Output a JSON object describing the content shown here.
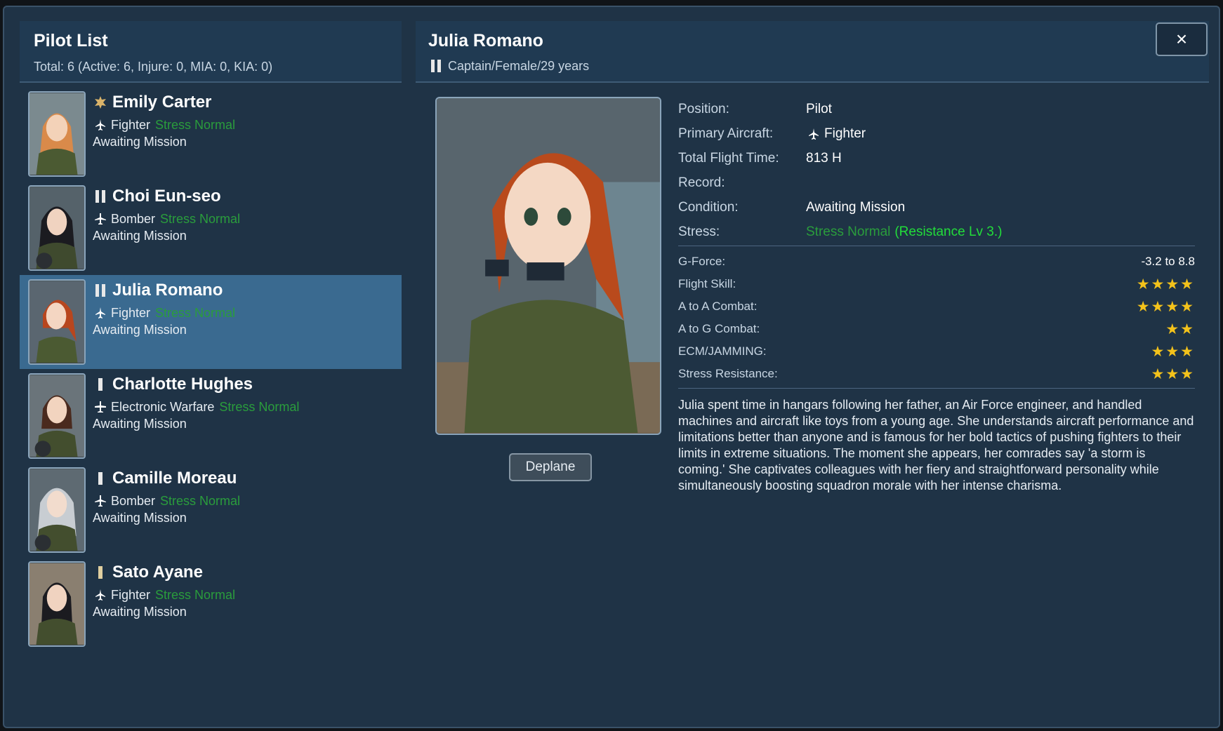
{
  "left": {
    "title": "Pilot List",
    "summary": "Total: 6 (Active: 6, Injure: 0, MIA: 0, KIA: 0)"
  },
  "pilots": [
    {
      "name": "Emily Carter",
      "type": "Fighter",
      "stress": "Stress Normal",
      "status": "Awaiting Mission",
      "rank_icon": "gold-leaf-rank-icon",
      "selected": false
    },
    {
      "name": "Choi Eun-seo",
      "type": "Bomber",
      "stress": "Stress Normal",
      "status": "Awaiting Mission",
      "rank_icon": "captain-bars-rank-icon",
      "selected": false
    },
    {
      "name": "Julia Romano",
      "type": "Fighter",
      "stress": "Stress Normal",
      "status": "Awaiting Mission",
      "rank_icon": "captain-bars-rank-icon",
      "selected": true
    },
    {
      "name": "Charlotte Hughes",
      "type": "Electronic Warfare",
      "stress": "Stress Normal",
      "status": "Awaiting Mission",
      "rank_icon": "lieutenant-bar-rank-icon",
      "selected": false
    },
    {
      "name": "Camille Moreau",
      "type": "Bomber",
      "stress": "Stress Normal",
      "status": "Awaiting Mission",
      "rank_icon": "lieutenant-bar-rank-icon",
      "selected": false
    },
    {
      "name": "Sato Ayane",
      "type": "Fighter",
      "stress": "Stress Normal",
      "status": "Awaiting Mission",
      "rank_icon": "ensign-bar-rank-icon",
      "selected": false
    }
  ],
  "detail": {
    "name": "Julia Romano",
    "subtitle": "Captain/Female/29 years",
    "close_label": "×",
    "deplane_label": "Deplane",
    "stats": [
      {
        "label": "Position:",
        "value": "Pilot"
      },
      {
        "label": "Primary Aircraft:",
        "value": "Fighter"
      },
      {
        "label": "Total Flight Time:",
        "value": "813 H"
      },
      {
        "label": "Record:",
        "value": ""
      },
      {
        "label": "Condition:",
        "value": "Awaiting Mission"
      }
    ],
    "stress_label": "Stress:",
    "stress_value": "Stress Normal",
    "stress_resist": "(Resistance Lv 3.)",
    "gforce_label": "G-Force:",
    "gforce_value": "-3.2 to 8.8",
    "attributes": [
      {
        "label": "Flight Skill:",
        "stars": 4,
        "value_text": "★★★★"
      },
      {
        "label": "A to A Combat:",
        "stars": 4,
        "value_text": "★★★★"
      },
      {
        "label": "A to G Combat:",
        "stars": 2,
        "value_text": "★★"
      },
      {
        "label": "ECM/JAMMING:",
        "stars": 3,
        "value_text": "★★★"
      },
      {
        "label": "Stress Resistance:",
        "stars": 3,
        "value_text": "★★★"
      }
    ],
    "bio": "Julia spent time in hangars following her father, an Air Force engineer, and handled machines and aircraft like toys from a young age. She understands aircraft performance and limitations better than anyone and is famous for her bold tactics of pushing fighters to their limits in extreme situations. The moment she appears, her comrades say 'a storm is coming.' She captivates colleagues with her fiery and straightforward personality while simultaneously boosting squadron morale with her intense charisma."
  },
  "colors": {
    "panel_bg": "#1f3346",
    "selected_row": "#3a6a90",
    "stress_green": "#2a9d3c",
    "resist_green": "#22dd3a",
    "star_gold": "#f3c21b"
  }
}
